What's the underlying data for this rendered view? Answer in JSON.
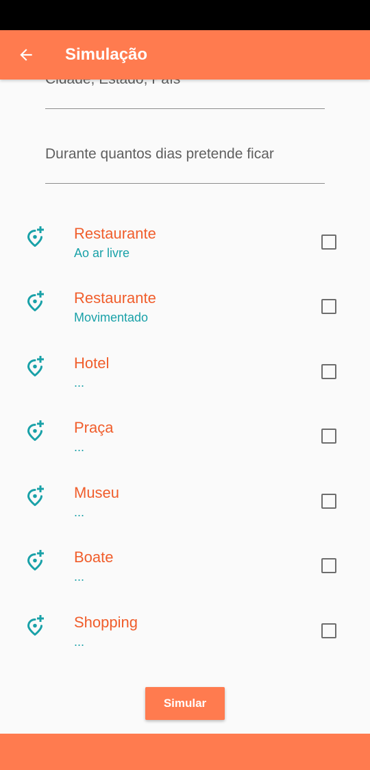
{
  "colors": {
    "primary": "#ff7b4f",
    "title_accent": "#f05d2b",
    "subtitle_teal": "#19a1a8"
  },
  "app_bar": {
    "title": "Simulação",
    "back_icon": "arrow-left-icon"
  },
  "form": {
    "city_field_text": "Cidade, Estado, País",
    "days_field_text": "Durante quantos dias pretende ficar"
  },
  "places": [
    {
      "title": "Restaurante",
      "subtitle": "Ao ar livre",
      "icon": "add-location-icon",
      "checked": false
    },
    {
      "title": "Restaurante",
      "subtitle": "Movimentado",
      "icon": "add-location-icon",
      "checked": false
    },
    {
      "title": "Hotel",
      "subtitle": "...",
      "icon": "add-location-icon",
      "checked": false
    },
    {
      "title": "Praça",
      "subtitle": "...",
      "icon": "add-location-icon",
      "checked": false
    },
    {
      "title": "Museu",
      "subtitle": "...",
      "icon": "add-location-icon",
      "checked": false
    },
    {
      "title": "Boate",
      "subtitle": "...",
      "icon": "add-location-icon",
      "checked": false
    },
    {
      "title": "Shopping",
      "subtitle": "...",
      "icon": "add-location-icon",
      "checked": false
    }
  ],
  "actions": {
    "simulate_label": "Simular"
  }
}
